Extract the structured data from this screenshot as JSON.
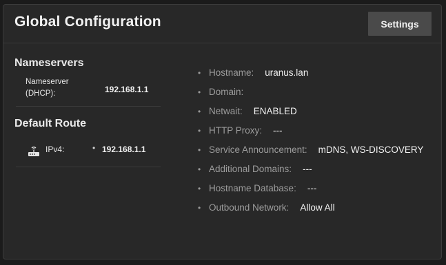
{
  "card": {
    "title": "Global Configuration",
    "settings_label": "Settings"
  },
  "nameservers": {
    "title": "Nameservers",
    "label": "Nameserver (DHCP):",
    "value": "192.168.1.1"
  },
  "default_route": {
    "title": "Default Route",
    "icon": "router-icon",
    "label": "IPv4:",
    "bullet": "•",
    "value": "192.168.1.1"
  },
  "info": {
    "bullet": "•",
    "items": [
      {
        "key": "Hostname:",
        "value": "uranus.lan"
      },
      {
        "key": "Domain:",
        "value": ""
      },
      {
        "key": "Netwait:",
        "value": "ENABLED"
      },
      {
        "key": "HTTP Proxy:",
        "value": "---"
      },
      {
        "key": "Service Announcement:",
        "value": "mDNS, WS-DISCOVERY"
      },
      {
        "key": "Additional Domains:",
        "value": "---"
      },
      {
        "key": "Hostname Database:",
        "value": "---"
      },
      {
        "key": "Outbound Network:",
        "value": "Allow All"
      }
    ]
  },
  "colors": {
    "page_bg": "#1b1b1b",
    "card_bg": "#282828",
    "button_bg": "#4a4a4a",
    "label_muted": "#9c9c9c",
    "text_bright": "#f2f2f2"
  }
}
